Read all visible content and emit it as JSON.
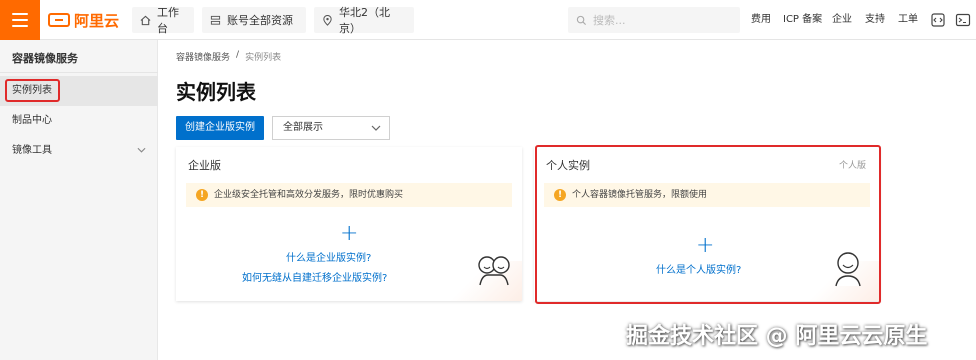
{
  "topbar": {
    "logo_text": "阿里云",
    "workbench": "工作台",
    "account_scope": "账号全部资源",
    "region": "华北2（北京）",
    "search_placeholder": "搜索...",
    "links": [
      "费用",
      "ICP 备案",
      "企业",
      "支持",
      "工单"
    ]
  },
  "sidebar": {
    "title": "容器镜像服务",
    "items": [
      {
        "label": "实例列表",
        "active": true
      },
      {
        "label": "制品中心",
        "active": false
      },
      {
        "label": "镜像工具",
        "active": false,
        "expandable": true
      }
    ]
  },
  "breadcrumb": {
    "root": "容器镜像服务",
    "separator": "/",
    "current": "实例列表"
  },
  "page_title": "实例列表",
  "toolbar": {
    "create_label": "创建企业版实例",
    "filter_value": "全部展示"
  },
  "cards": {
    "enterprise": {
      "title": "企业版",
      "notice": "企业级安全托管和高效分发服务，限时优惠购买",
      "link1": "什么是企业版实例?",
      "link2": "如何无缝从自建迁移企业版实例?"
    },
    "personal": {
      "title": "个人实例",
      "tag": "个人版",
      "notice": "个人容器镜像托管服务，限额使用",
      "link1": "什么是个人版实例?"
    }
  },
  "watermark": "掘金技术社区 @ 阿里云云原生",
  "colors": {
    "brand": "#ff6a00",
    "primary": "#0070cc",
    "highlight": "#e02a2a",
    "notice_bg": "#fff7e6"
  }
}
